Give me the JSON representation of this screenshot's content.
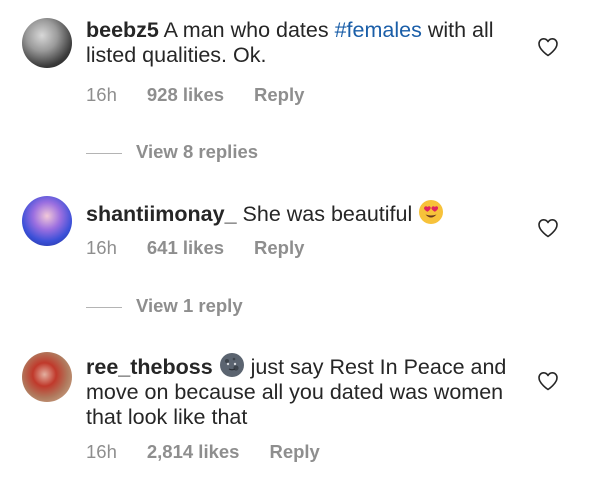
{
  "comments": [
    {
      "username": "beebz5",
      "text_before": " A man who dates ",
      "hashtag": "#females",
      "text_after": " with all listed qualities.  Ok.",
      "time": "16h",
      "likes": "928 likes",
      "reply": "Reply",
      "avatar_icon": "user-avatar-photo",
      "like_icon": "heart-outline-icon"
    },
    {
      "username": "shantiimonay_",
      "text": " She was beautiful ",
      "emoji": "heart-eyes-emoji",
      "time": "16h",
      "likes": "641 likes",
      "reply": "Reply",
      "avatar_icon": "user-avatar-photo",
      "like_icon": "heart-outline-icon"
    },
    {
      "username": "ree_theboss",
      "emoji": "new-moon-face-emoji",
      "text": " just say Rest In Peace and move on because all you dated was women that look like that",
      "time": "16h",
      "likes": "2,814 likes",
      "reply": "Reply",
      "avatar_icon": "user-avatar-photo",
      "like_icon": "heart-outline-icon"
    }
  ],
  "view_replies": [
    "View 8 replies",
    "View 1 reply"
  ],
  "colors": {
    "text": "#262626",
    "secondary": "#8e8e8e",
    "hashtag": "#1a5ea8",
    "background": "#ffffff"
  }
}
